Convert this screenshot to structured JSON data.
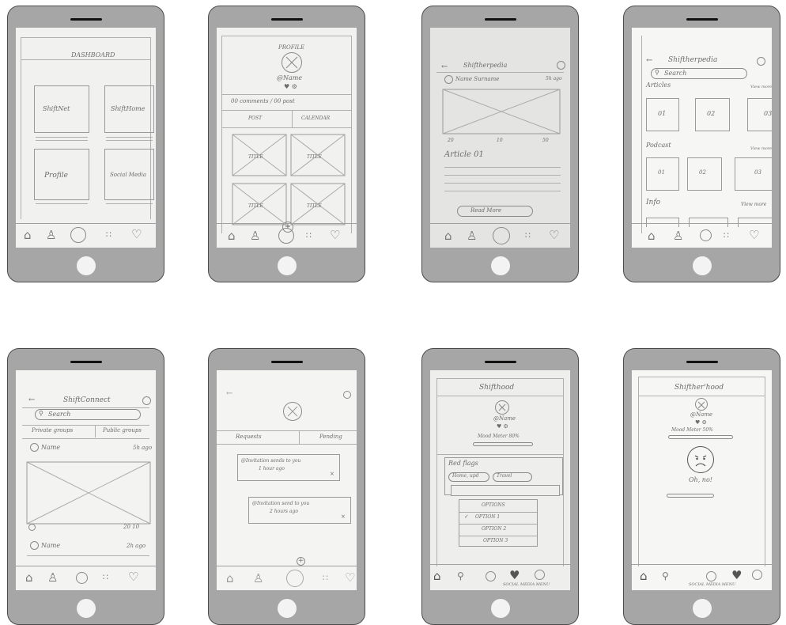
{
  "screens": {
    "dashboard": {
      "title": "DASHBOARD",
      "tiles": [
        "ShiftNet",
        "ShiftHome",
        "Profile",
        "Social Media"
      ]
    },
    "profile": {
      "title": "PROFILE",
      "name": "@Name",
      "stats": "00 comments / 00 post",
      "tabs": [
        "POST",
        "CALENDAR"
      ],
      "card_title": "TITLE"
    },
    "shiftherpedia_detail": {
      "title": "Shiftherpedia",
      "author": "Name Surname",
      "time": "5h ago",
      "stats": [
        "20",
        "10",
        "50"
      ],
      "heading": "Article 01",
      "button": "Read More"
    },
    "shiftherpedia_home": {
      "title": "Shiftherpedia",
      "search": "Search",
      "articles": "Articles",
      "view_more": "View more",
      "article_items": [
        "01",
        "02",
        "03"
      ],
      "podcast": "Podcast",
      "podcast_items": [
        "01",
        "02",
        "03"
      ],
      "info": "Info"
    },
    "shiftconnect": {
      "title": "ShiftConnect",
      "search": "Search",
      "tabs": [
        "Private groups",
        "Public groups"
      ],
      "author": "Name",
      "time": "5h ago",
      "stats": "20 10",
      "author2": "Name",
      "time2": "2h ago"
    },
    "requests": {
      "tabs": [
        "Requests",
        "Pending"
      ],
      "inv1": "@Invitation sends to you",
      "inv1_time": "1 hour ago",
      "inv2": "@Invitation send to you",
      "inv2_time": "2 hours ago"
    },
    "shifthood_options": {
      "title": "Shifthood",
      "name": "@Name",
      "mood": "Mood Meter 80%",
      "red_flags": "Red flags",
      "chips": [
        "Home, upd",
        "Travel"
      ],
      "options": [
        "OPTIONS",
        "OPTION 1",
        "OPTION 2",
        "OPTION 3"
      ],
      "nav_label": "SOCIAL MEDIA MENU"
    },
    "shifthood_sad": {
      "title": "Shifther'hood",
      "name": "@Name",
      "mood": "Mood Meter 50%",
      "message": "Oh, no!",
      "nav_label": "SOCIAL MEDIA MENU"
    }
  }
}
